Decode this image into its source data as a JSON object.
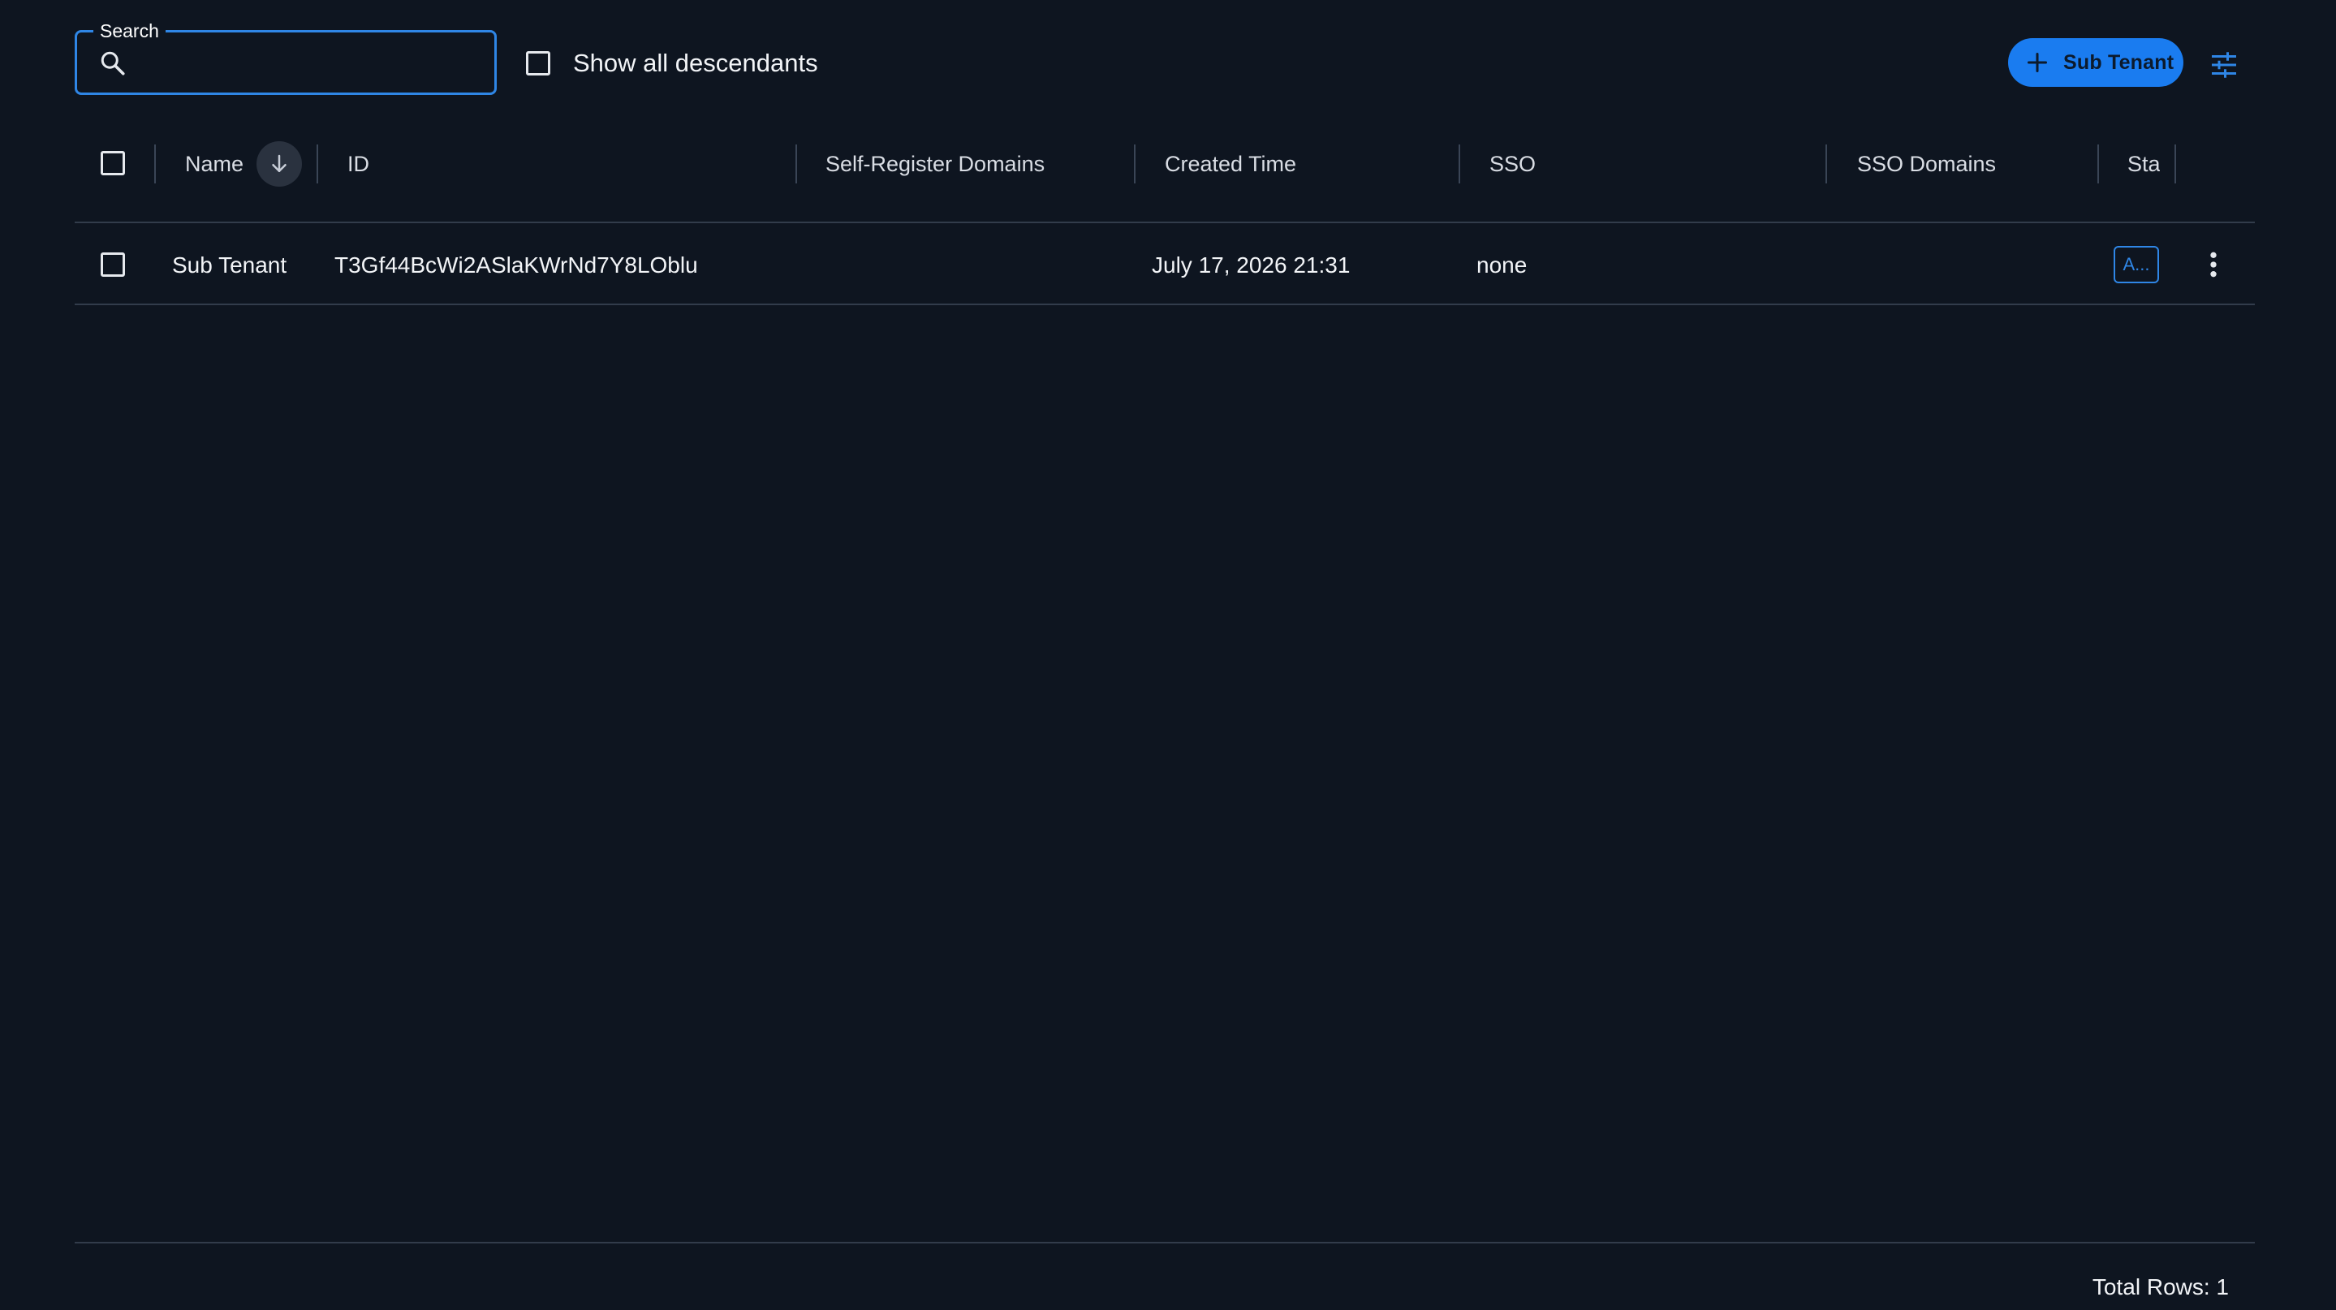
{
  "toolbar": {
    "search_label": "Search",
    "search_value": "",
    "show_descendants_label": "Show all descendants",
    "show_descendants_checked": false,
    "add_button_label": "Sub Tenant"
  },
  "table": {
    "columns": [
      {
        "key": "name",
        "label": "Name",
        "sort": "descending"
      },
      {
        "key": "id",
        "label": "ID"
      },
      {
        "key": "self_register_domains",
        "label": "Self-Register Domains"
      },
      {
        "key": "created_time",
        "label": "Created Time"
      },
      {
        "key": "sso",
        "label": "SSO"
      },
      {
        "key": "sso_domains",
        "label": "SSO Domains"
      },
      {
        "key": "status",
        "label": "Sta"
      }
    ],
    "rows": [
      {
        "name": "Sub Tenant",
        "id": "T3Gf44BcWi2ASlaKWrNd7Y8LOblu",
        "self_register_domains": "",
        "created_time": "July 17, 2026 21:31",
        "sso": "none",
        "sso_domains": "",
        "status": "A..."
      }
    ]
  },
  "footer": {
    "total_rows_text": "Total Rows: 1"
  },
  "icons": {
    "search": "search-icon",
    "plus": "plus-icon",
    "filter": "tune-icon",
    "sort": "arrow-down-icon",
    "row_menu": "more-vertical-icon"
  },
  "colors": {
    "background": "#0e1520",
    "accent": "#1a7cf0",
    "divider": "#323c4b"
  }
}
